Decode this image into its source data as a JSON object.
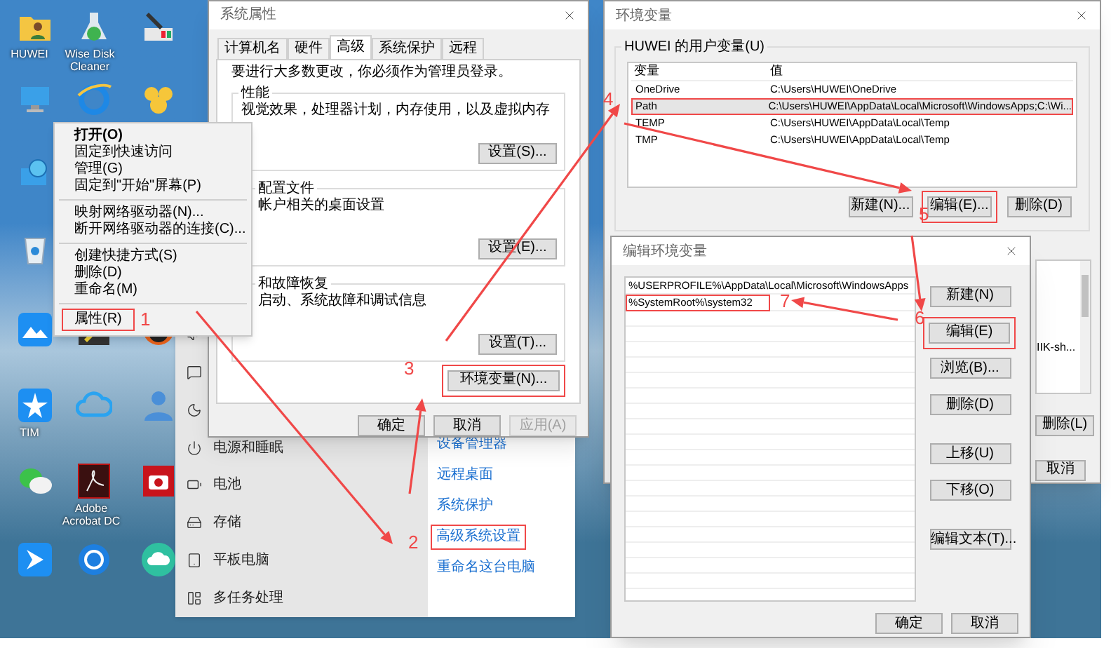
{
  "desktop_labels": [
    "HUWEI",
    "Wise Disk Cleaner",
    "TIM",
    "Adobe Acrobat DC"
  ],
  "context_menu": {
    "items": [
      {
        "kind": "item",
        "label": "打开(O)",
        "default": true,
        "highlighted": false
      },
      {
        "kind": "item",
        "label": "固定到快速访问",
        "default": false,
        "highlighted": false
      },
      {
        "kind": "item",
        "label": "管理(G)",
        "default": false,
        "highlighted": false
      },
      {
        "kind": "item",
        "label": "固定到\"开始\"屏幕(P)",
        "default": false,
        "highlighted": false
      },
      {
        "kind": "separator"
      },
      {
        "kind": "item",
        "label": "映射网络驱动器(N)...",
        "default": false,
        "highlighted": false
      },
      {
        "kind": "item",
        "label": "断开网络驱动器的连接(C)...",
        "default": false,
        "highlighted": false
      },
      {
        "kind": "separator"
      },
      {
        "kind": "item",
        "label": "创建快捷方式(S)",
        "default": false,
        "highlighted": false
      },
      {
        "kind": "item",
        "label": "删除(D)",
        "default": false,
        "highlighted": false
      },
      {
        "kind": "item",
        "label": "重命名(M)",
        "default": false,
        "highlighted": false
      },
      {
        "kind": "separator"
      },
      {
        "kind": "item",
        "label": "属性(R)",
        "default": false,
        "highlighted": true
      }
    ]
  },
  "settings": {
    "nav_items": [
      {
        "label": "电源和睡眠"
      },
      {
        "label": "电池"
      },
      {
        "label": "存储"
      },
      {
        "label": "平板电脑"
      },
      {
        "label": "多任务处理"
      }
    ],
    "links": [
      {
        "label": "设备管理器",
        "highlighted": false
      },
      {
        "label": "远程桌面",
        "highlighted": false
      },
      {
        "label": "系统保护",
        "highlighted": false
      },
      {
        "label": "高级系统设置",
        "highlighted": true
      },
      {
        "label": "重命名这台电脑",
        "highlighted": false
      }
    ]
  },
  "system_properties": {
    "title": "系统属性",
    "tabs": [
      {
        "label": "计算机名",
        "selected": false
      },
      {
        "label": "硬件",
        "selected": false
      },
      {
        "label": "高级",
        "selected": true
      },
      {
        "label": "系统保护",
        "selected": false
      },
      {
        "label": "远程",
        "selected": false
      }
    ],
    "notice": "要进行大多数更改，你必须作为管理员登录。",
    "groups": [
      {
        "title": "性能",
        "description": "视觉效果，处理器计划，内存使用，以及虚拟内存",
        "button": "设置(S)..."
      },
      {
        "title": "配置文件",
        "description": "帐户相关的桌面设置",
        "button": "设置(E)..."
      },
      {
        "title": "和故障恢复",
        "description": "启动、系统故障和调试信息",
        "button": "设置(T)..."
      }
    ],
    "env_button": {
      "label": "环境变量(N)...",
      "highlighted": true
    },
    "buttons": [
      {
        "label": "确定",
        "disabled": false
      },
      {
        "label": "取消",
        "disabled": false
      },
      {
        "label": "应用(A)",
        "disabled": true
      }
    ]
  },
  "environment_variables": {
    "title": "环境变量",
    "user_group": "HUWEI 的用户变量(U)",
    "columns": [
      "变量",
      "值"
    ],
    "rows": [
      {
        "name": "OneDrive",
        "value": "C:\\Users\\HUWEI\\OneDrive",
        "selected": false,
        "highlighted": false
      },
      {
        "name": "Path",
        "value": "C:\\Users\\HUWEI\\AppData\\Local\\Microsoft\\WindowsApps;C:\\Wi...",
        "selected": true,
        "highlighted": true
      },
      {
        "name": "TEMP",
        "value": "C:\\Users\\HUWEI\\AppData\\Local\\Temp",
        "selected": false,
        "highlighted": false
      },
      {
        "name": "TMP",
        "value": "C:\\Users\\HUWEI\\AppData\\Local\\Temp",
        "selected": false,
        "highlighted": false
      }
    ],
    "buttons": [
      {
        "label": "新建(N)...",
        "highlighted": false
      },
      {
        "label": "编辑(E)...",
        "highlighted": true
      },
      {
        "label": "删除(D)",
        "highlighted": false
      }
    ],
    "system_list_text": "IIK-sh...",
    "system_buttons": [
      "删除(L)",
      "取消"
    ]
  },
  "edit_env": {
    "title": "编辑环境变量",
    "entries": [
      {
        "value": "%USERPROFILE%\\AppData\\Local\\Microsoft\\WindowsApps",
        "highlighted": false
      },
      {
        "value": "%SystemRoot%\\system32",
        "highlighted": true
      }
    ],
    "buttons": [
      {
        "label": "新建(N)",
        "highlighted": false
      },
      {
        "label": "编辑(E)",
        "highlighted": true
      },
      {
        "label": "浏览(B)...",
        "highlighted": false
      },
      {
        "label": "删除(D)",
        "highlighted": false
      },
      {
        "label": "上移(U)",
        "highlighted": false
      },
      {
        "label": "下移(O)",
        "highlighted": false
      },
      {
        "label": "编辑文本(T)...",
        "highlighted": false
      }
    ],
    "footer_buttons": [
      "确定",
      "取消"
    ]
  },
  "annotations": [
    {
      "label": "1"
    },
    {
      "label": "2"
    },
    {
      "label": "3"
    },
    {
      "label": "4"
    },
    {
      "label": "5"
    },
    {
      "label": "6"
    },
    {
      "label": "7"
    }
  ]
}
